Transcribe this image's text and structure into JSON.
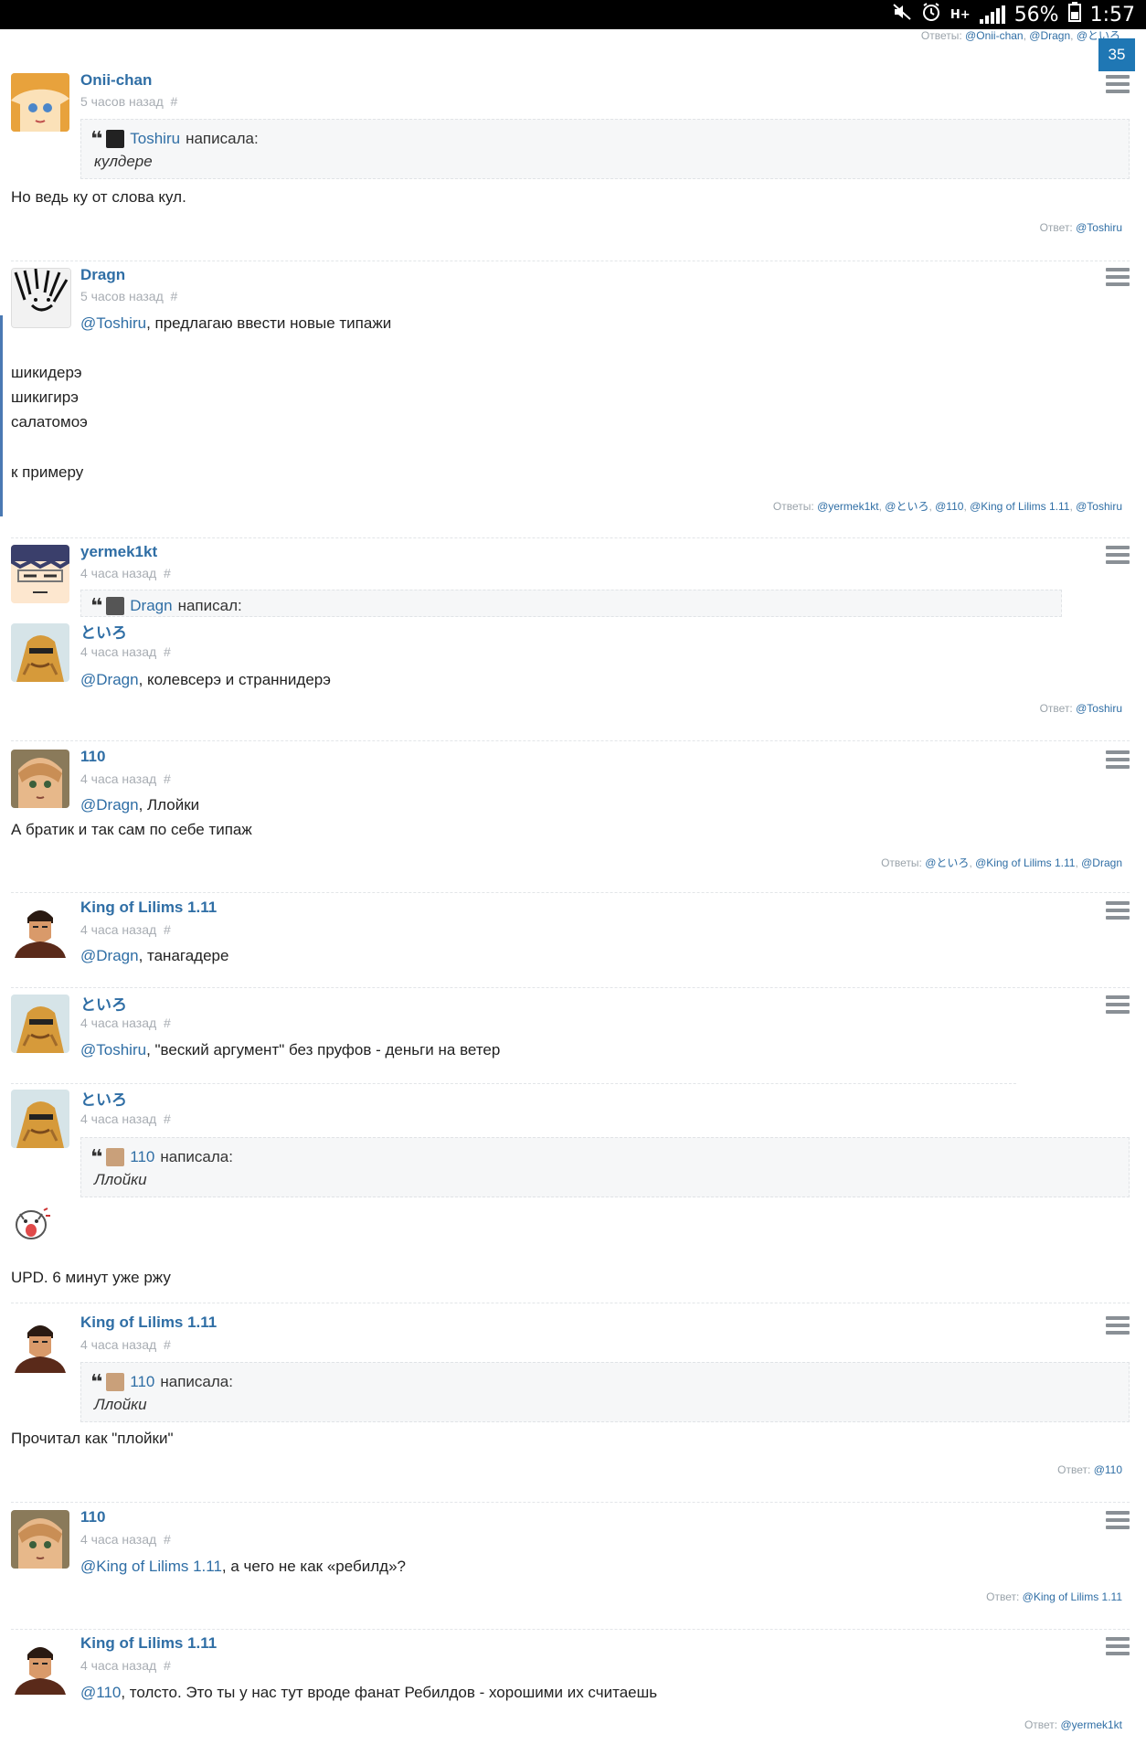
{
  "status_bar": {
    "battery": "56%",
    "time": "1:57",
    "network": "H+"
  },
  "top_replies": {
    "label": "Ответы:",
    "links": [
      "@Onii-chan",
      "@Dragn",
      "@といろ"
    ]
  },
  "badge": "35",
  "posts": [
    {
      "author": "Onii-chan",
      "time": "5 часов назад",
      "hash": "#",
      "quote": {
        "name": "Toshiru",
        "verb": "написала:",
        "text": "кулдере"
      },
      "body": "Но ведь ку от слова кул.",
      "reply_label": "Ответ:",
      "reply_links": [
        "@Toshiru"
      ]
    },
    {
      "author": "Dragn",
      "time": "5 часов назад",
      "hash": "#",
      "mention": "@Toshiru",
      "mention_rest": ", предлагаю ввести новые типажи",
      "lines": [
        "шикидерэ",
        "шикигирэ",
        "салатомоэ",
        "",
        "к примеру"
      ],
      "reply_label": "Ответы:",
      "reply_links": [
        "@yermek1kt",
        "@といろ",
        "@110",
        "@King of Lilims 1.11",
        "@Toshiru"
      ]
    },
    {
      "author": "yermek1kt",
      "time": "4 часа назад",
      "hash": "#",
      "quote": {
        "name": "Dragn",
        "verb": "написал:"
      }
    },
    {
      "author": "といろ",
      "time": "4 часа назад",
      "hash": "#",
      "mention": "@Dragn",
      "mention_rest": ", колевсерэ и страннидерэ",
      "reply_label": "Ответ:",
      "reply_links": [
        "@Toshiru"
      ]
    },
    {
      "author": "110",
      "time": "4 часа назад",
      "hash": "#",
      "mention": "@Dragn",
      "mention_rest": ", Ллойки",
      "body": "А братик и так сам по себе типаж",
      "reply_label": "Ответы:",
      "reply_links": [
        "@といろ",
        "@King of Lilims 1.11",
        "@Dragn"
      ]
    },
    {
      "author": "King of Lilims 1.11",
      "time": "4 часа назад",
      "hash": "#",
      "mention": "@Dragn",
      "mention_rest": ", танагадере"
    },
    {
      "author": "といろ",
      "time": "4 часа назад",
      "hash": "#",
      "mention": "@Toshiru",
      "mention_rest": ", \"веский аргумент\" без пруфов - деньги на ветер"
    },
    {
      "author": "といろ",
      "time": "4 часа назад",
      "hash": "#",
      "quote": {
        "name": "110",
        "verb": "написала:",
        "text": "Ллойки"
      },
      "body": "UPD. 6 минут уже ржу"
    },
    {
      "author": "King of Lilims 1.11",
      "time": "4 часа назад",
      "hash": "#",
      "quote": {
        "name": "110",
        "verb": "написала:",
        "text": "Ллойки"
      },
      "body": "Прочитал как \"плойки\"",
      "reply_label": "Ответ:",
      "reply_links": [
        "@110"
      ]
    },
    {
      "author": "110",
      "time": "4 часа назад",
      "hash": "#",
      "mention": "@King of Lilims 1.11",
      "mention_rest": ", а чего не как «ребилд»?",
      "reply_label": "Ответ:",
      "reply_links": [
        "@King of Lilims 1.11"
      ]
    },
    {
      "author": "King of Lilims 1.11",
      "time": "4 часа назад",
      "hash": "#",
      "mention": "@110",
      "mention_rest": ", толсто. Это ты у нас тут вроде фанат Ребилдов - хорошими их считаешь",
      "reply_label": "Ответ:",
      "reply_links": [
        "@yermek1kt"
      ]
    }
  ],
  "colors": {
    "link": "#2f6ea5",
    "meta": "#a8adb3",
    "badge": "#1f77b4",
    "quote_bg": "#f6f7f8"
  },
  "icons": [
    "mute-icon",
    "alarm-icon",
    "signal-icon",
    "battery-icon",
    "quote-icon",
    "post-menu-icon",
    "sticker-icon"
  ]
}
